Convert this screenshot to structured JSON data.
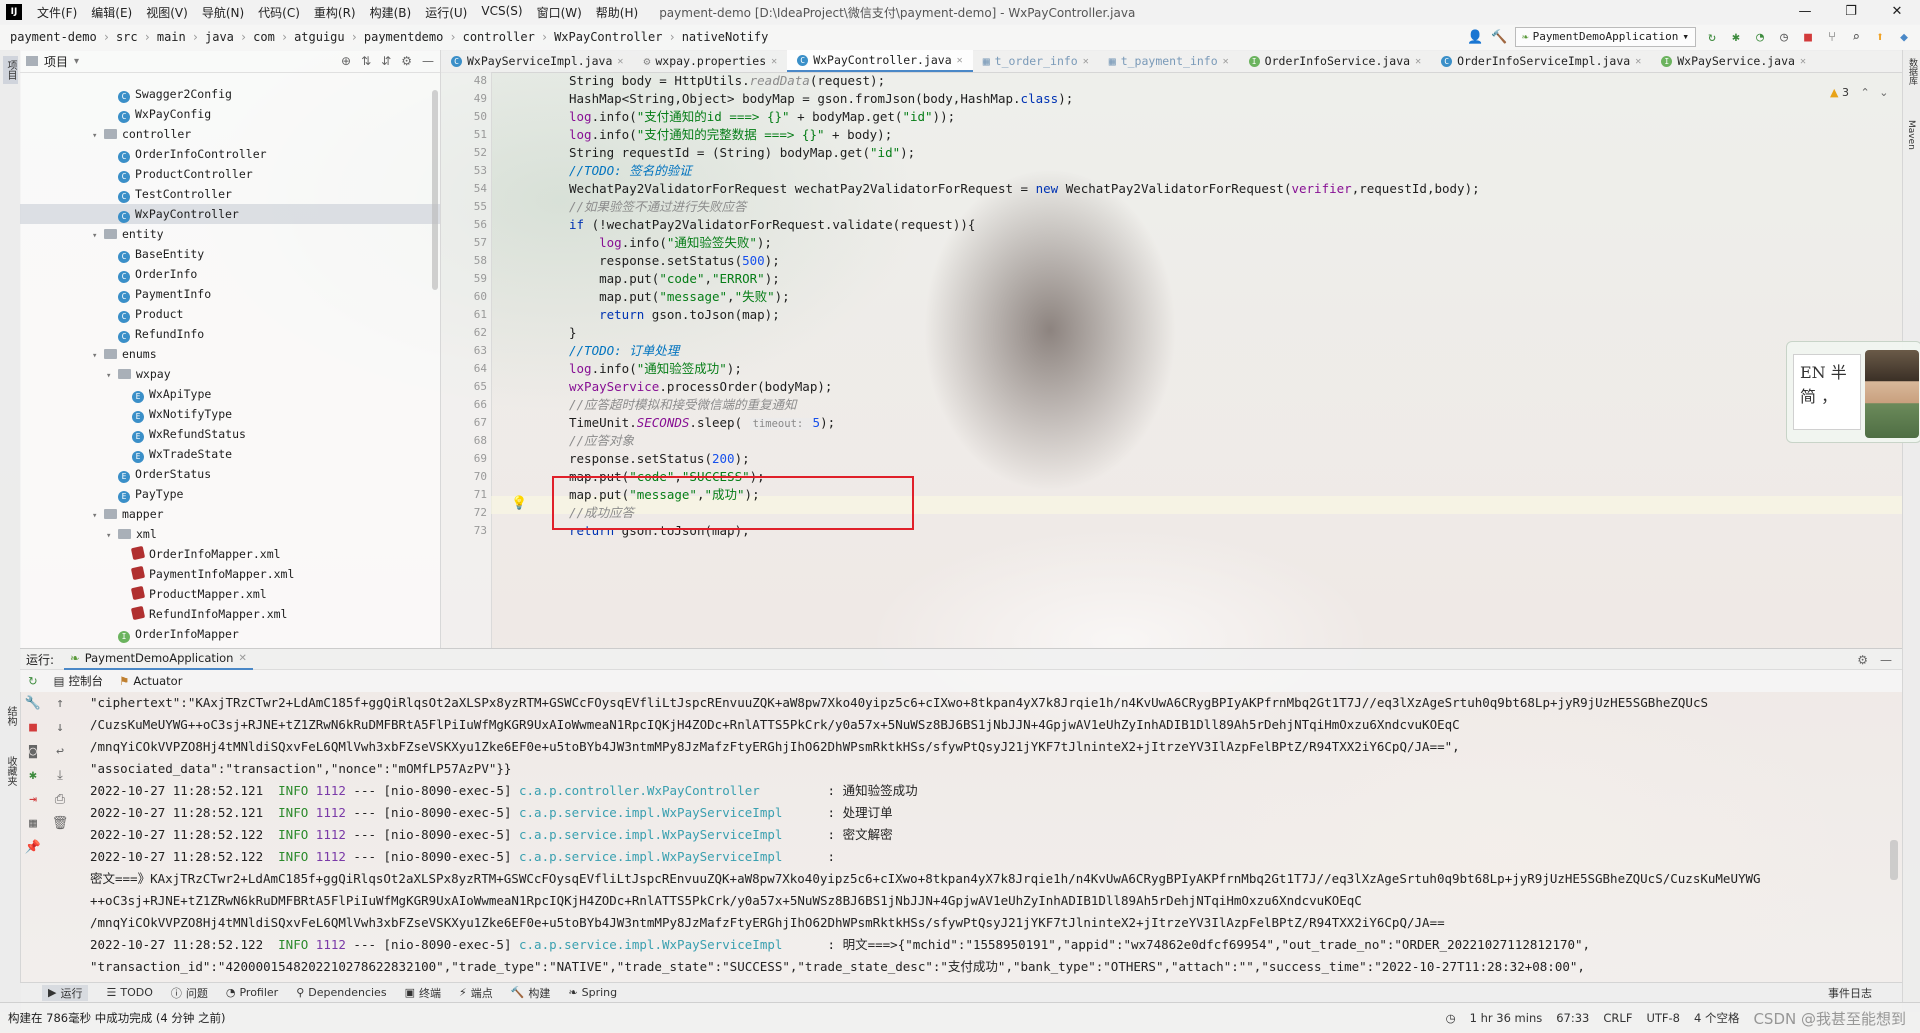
{
  "window": {
    "title": "payment-demo [D:\\IdeaProject\\微信支付\\payment-demo] - WxPayController.java",
    "logo": "IJ"
  },
  "menu": [
    "文件(F)",
    "编辑(E)",
    "视图(V)",
    "导航(N)",
    "代码(C)",
    "重构(R)",
    "构建(B)",
    "运行(U)",
    "VCS(S)",
    "窗口(W)",
    "帮助(H)"
  ],
  "breadcrumb": [
    "payment-demo",
    "src",
    "main",
    "java",
    "com",
    "atguigu",
    "paymentdemo",
    "controller",
    "WxPayController",
    "nativeNotify"
  ],
  "toolbar": {
    "run_config": "PaymentDemoApplication"
  },
  "left_strip": {
    "project": "项目",
    "structure": "结构",
    "favorites": "收藏夹"
  },
  "right_strip": {
    "database": "数据库",
    "maven": "Maven"
  },
  "project_panel": {
    "title": "项目",
    "tree": [
      {
        "label": "Swagger2Config",
        "icon": "class",
        "depth": 3
      },
      {
        "label": "WxPayConfig",
        "icon": "class",
        "depth": 3
      },
      {
        "label": "controller",
        "icon": "folder",
        "depth": 2,
        "open": true
      },
      {
        "label": "OrderInfoController",
        "icon": "class",
        "depth": 3
      },
      {
        "label": "ProductController",
        "icon": "class",
        "depth": 3
      },
      {
        "label": "TestController",
        "icon": "class",
        "depth": 3
      },
      {
        "label": "WxPayController",
        "icon": "class",
        "depth": 3,
        "selected": true
      },
      {
        "label": "entity",
        "icon": "folder",
        "depth": 2,
        "open": true
      },
      {
        "label": "BaseEntity",
        "icon": "class",
        "depth": 3
      },
      {
        "label": "OrderInfo",
        "icon": "class",
        "depth": 3
      },
      {
        "label": "PaymentInfo",
        "icon": "class",
        "depth": 3
      },
      {
        "label": "Product",
        "icon": "class",
        "depth": 3
      },
      {
        "label": "RefundInfo",
        "icon": "class",
        "depth": 3
      },
      {
        "label": "enums",
        "icon": "folder",
        "depth": 2,
        "open": true
      },
      {
        "label": "wxpay",
        "icon": "folder",
        "depth": 3,
        "open": true
      },
      {
        "label": "WxApiType",
        "icon": "enum",
        "depth": 4
      },
      {
        "label": "WxNotifyType",
        "icon": "enum",
        "depth": 4
      },
      {
        "label": "WxRefundStatus",
        "icon": "enum",
        "depth": 4
      },
      {
        "label": "WxTradeState",
        "icon": "enum",
        "depth": 4
      },
      {
        "label": "OrderStatus",
        "icon": "enum",
        "depth": 3
      },
      {
        "label": "PayType",
        "icon": "enum",
        "depth": 3
      },
      {
        "label": "mapper",
        "icon": "folder",
        "depth": 2,
        "open": true
      },
      {
        "label": "xml",
        "icon": "folder",
        "depth": 3,
        "open": true
      },
      {
        "label": "OrderInfoMapper.xml",
        "icon": "xml",
        "depth": 4
      },
      {
        "label": "PaymentInfoMapper.xml",
        "icon": "xml",
        "depth": 4
      },
      {
        "label": "ProductMapper.xml",
        "icon": "xml",
        "depth": 4
      },
      {
        "label": "RefundInfoMapper.xml",
        "icon": "xml",
        "depth": 4
      },
      {
        "label": "OrderInfoMapper",
        "icon": "interface",
        "depth": 3
      }
    ]
  },
  "tabs": [
    {
      "label": "WxPayServiceImpl.java",
      "icon": "class"
    },
    {
      "label": "wxpay.properties",
      "icon": "file"
    },
    {
      "label": "WxPayController.java",
      "icon": "class",
      "active": true
    },
    {
      "label": "t_order_info",
      "icon": "table",
      "muted": true
    },
    {
      "label": "t_payment_info",
      "icon": "table",
      "muted": true
    },
    {
      "label": "OrderInfoService.java",
      "icon": "interface"
    },
    {
      "label": "OrderInfoServiceImpl.java",
      "icon": "class"
    },
    {
      "label": "WxPayService.java",
      "icon": "interface"
    }
  ],
  "editor": {
    "warning_count": "3",
    "line_numbers": [
      "48",
      "49",
      "50",
      "51",
      "52",
      "53",
      "54",
      "55",
      "56",
      "57",
      "58",
      "59",
      "60",
      "61",
      "62",
      "63",
      "64",
      "65",
      "66",
      "67",
      "68",
      "69",
      "70",
      "71",
      "72",
      "73"
    ],
    "code": [
      [
        {
          "t": "String body = HttpUtils.",
          "c": ""
        },
        {
          "t": "readData",
          "c": "cmt"
        },
        {
          "t": "(request);",
          "c": ""
        }
      ],
      [
        {
          "t": "HashMap<String,Object> bodyMap = gson.fromJson(body,HashMap.",
          "c": ""
        },
        {
          "t": "class",
          "c": "kw"
        },
        {
          "t": ");",
          "c": ""
        }
      ],
      [
        {
          "t": "log",
          "c": "fld"
        },
        {
          "t": ".info(",
          "c": ""
        },
        {
          "t": "\"支付通知的id ===> {}\"",
          "c": "str"
        },
        {
          "t": " + bodyMap.get(",
          "c": ""
        },
        {
          "t": "\"id\"",
          "c": "str"
        },
        {
          "t": "));",
          "c": ""
        }
      ],
      [
        {
          "t": "log",
          "c": "fld"
        },
        {
          "t": ".info(",
          "c": ""
        },
        {
          "t": "\"支付通知的完整数据 ===> {}\"",
          "c": "str"
        },
        {
          "t": " + body);",
          "c": ""
        }
      ],
      [
        {
          "t": "String requestId = (String) bodyMap.get(",
          "c": ""
        },
        {
          "t": "\"id\"",
          "c": "str"
        },
        {
          "t": ");",
          "c": ""
        }
      ],
      [
        {
          "t": "//TODO:",
          "c": "todo"
        },
        {
          "t": " 签名的验证",
          "c": "todo"
        }
      ],
      [
        {
          "t": "WechatPay2ValidatorForRequest wechatPay2ValidatorForRequest = ",
          "c": ""
        },
        {
          "t": "new",
          "c": "kw"
        },
        {
          "t": " WechatPay2ValidatorForRequest(",
          "c": ""
        },
        {
          "t": "verifier",
          "c": "fld"
        },
        {
          "t": ",requestId,body);",
          "c": ""
        }
      ],
      [
        {
          "t": "//如果验签不通过进行失败应答",
          "c": "cmt"
        }
      ],
      [
        {
          "t": "if",
          "c": "kw"
        },
        {
          "t": " (!wechatPay2ValidatorForRequest.validate(request)){",
          "c": ""
        }
      ],
      [
        {
          "t": "    ",
          "c": ""
        },
        {
          "t": "log",
          "c": "fld"
        },
        {
          "t": ".info(",
          "c": ""
        },
        {
          "t": "\"通知验签失败\"",
          "c": "str"
        },
        {
          "t": ");",
          "c": ""
        }
      ],
      [
        {
          "t": "    response.setStatus(",
          "c": ""
        },
        {
          "t": "500",
          "c": "num"
        },
        {
          "t": ");",
          "c": ""
        }
      ],
      [
        {
          "t": "    map.put(",
          "c": ""
        },
        {
          "t": "\"code\"",
          "c": "str"
        },
        {
          "t": ",",
          "c": ""
        },
        {
          "t": "\"ERROR\"",
          "c": "str"
        },
        {
          "t": ");",
          "c": ""
        }
      ],
      [
        {
          "t": "    map.put(",
          "c": ""
        },
        {
          "t": "\"message\"",
          "c": "str"
        },
        {
          "t": ",",
          "c": ""
        },
        {
          "t": "\"失败\"",
          "c": "str"
        },
        {
          "t": ");",
          "c": ""
        }
      ],
      [
        {
          "t": "    ",
          "c": ""
        },
        {
          "t": "return",
          "c": "kw"
        },
        {
          "t": " gson.toJson(map);",
          "c": ""
        }
      ],
      [
        {
          "t": "}",
          "c": ""
        }
      ],
      [
        {
          "t": "//TODO:",
          "c": "todo"
        },
        {
          "t": " 订单处理",
          "c": "todo"
        }
      ],
      [
        {
          "t": "log",
          "c": "fld"
        },
        {
          "t": ".info(",
          "c": ""
        },
        {
          "t": "\"通知验签成功\"",
          "c": "str"
        },
        {
          "t": ");",
          "c": ""
        }
      ],
      [
        {
          "t": "wxPayService",
          "c": "fld"
        },
        {
          "t": ".processOrder(bodyMap);",
          "c": ""
        }
      ],
      [
        {
          "t": "//应答超时模拟和接受微信端的重复通知",
          "c": "cmt"
        }
      ],
      [
        {
          "t": "TimeUnit.",
          "c": ""
        },
        {
          "t": "SECONDS",
          "c": "sfld"
        },
        {
          "t": ".sleep( ",
          "c": ""
        },
        {
          "t": "timeout: ",
          "c": "hint"
        },
        {
          "t": "5",
          "c": "num"
        },
        {
          "t": ");",
          "c": ""
        }
      ],
      [
        {
          "t": "//应答对象",
          "c": "cmt"
        }
      ],
      [
        {
          "t": "response.setStatus(",
          "c": ""
        },
        {
          "t": "200",
          "c": "num"
        },
        {
          "t": ");",
          "c": ""
        }
      ],
      [
        {
          "t": "map.put(",
          "c": ""
        },
        {
          "t": "\"code\"",
          "c": "str"
        },
        {
          "t": ",",
          "c": ""
        },
        {
          "t": "\"SUCCESS\"",
          "c": "str"
        },
        {
          "t": ");",
          "c": ""
        }
      ],
      [
        {
          "t": "map.put(",
          "c": ""
        },
        {
          "t": "\"message\"",
          "c": "str"
        },
        {
          "t": ",",
          "c": ""
        },
        {
          "t": "\"成功\"",
          "c": "str"
        },
        {
          "t": ");",
          "c": ""
        }
      ],
      [
        {
          "t": "//成功应答",
          "c": "cmt"
        }
      ],
      [
        {
          "t": "return",
          "c": "kw"
        },
        {
          "t": " gson.toJson(map);",
          "c": ""
        }
      ]
    ]
  },
  "ime": {
    "line1": "EN 半",
    "line2": "简 ，"
  },
  "run_panel": {
    "label": "运行:",
    "app_tab": "PaymentDemoApplication",
    "subtabs": [
      "控制台",
      "Actuator"
    ],
    "console": [
      [
        {
          "t": "\"ciphertext\":\"KAxjTRzCTwr2+LdAmC185f+ggQiRlqsOt2aXLSPx8yzRTM+GSWCcFOysqEVfliLtJspcREnvuuZQK+aW8pw7Xko40yipz5c6+cIXwo+8tkpan4yX7k8Jrqie1h/n4KvUwA6CRygBPIyAKPfrnMbq2Gt1T7J//eq3lXzAgeSrtuh0q9bt68Lp+jyR9jUzHE5SGBheZQUcS",
          "c": ""
        }
      ],
      [
        {
          "t": "/CuzsKuMeUYWG++oC3sj+RJNE+tZ1ZRwN6kRuDMFBRtA5FlPiIuWfMgKGR9UxAIoWwmeaN1RpcIQKjH4ZODc+RnlATTS5PkCrk/y0a57x+5NuWSz8BJ6BS1jNbJJN+4GpjwAV1eUhZyInhADIB1Dll89Ah5rDehjNTqiHmOxzu6XndcvuKOEqC",
          "c": ""
        }
      ],
      [
        {
          "t": "/mnqYiCOkVVPZO8Hj4tMNldiSQxvFeL6QMlVwh3xbFZseVSKXyu1Zke6EF0e+u5toBYb4JW3ntmMPy8JzMafzFtyERGhjIhO62DhWPsmRktkHSs/sfywPtQsyJ21jYKF7tJlninteX2+jItrzeYV3IlAzpFelBPtZ/R94TXX2iY6CpQ/JA==\",",
          "c": ""
        }
      ],
      [
        {
          "t": "\"associated_data\":\"transaction\",\"nonce\":\"mOMfLP57AzPV\"}}",
          "c": ""
        }
      ],
      [
        {
          "t": "2022-10-27 11:28:52.121  ",
          "c": ""
        },
        {
          "t": "INFO",
          "c": "info"
        },
        {
          "t": " ",
          "c": ""
        },
        {
          "t": "1112",
          "c": "pid"
        },
        {
          "t": " --- [nio-8090-exec-5] ",
          "c": ""
        },
        {
          "t": "c.a.p.controller.WxPayController        ",
          "c": "logger"
        },
        {
          "t": " : 通知验签成功",
          "c": ""
        }
      ],
      [
        {
          "t": "2022-10-27 11:28:52.121  ",
          "c": ""
        },
        {
          "t": "INFO",
          "c": "info"
        },
        {
          "t": " ",
          "c": ""
        },
        {
          "t": "1112",
          "c": "pid"
        },
        {
          "t": " --- [nio-8090-exec-5] ",
          "c": ""
        },
        {
          "t": "c.a.p.service.impl.WxPayServiceImpl     ",
          "c": "logger"
        },
        {
          "t": " : 处理订单",
          "c": ""
        }
      ],
      [
        {
          "t": "2022-10-27 11:28:52.122  ",
          "c": ""
        },
        {
          "t": "INFO",
          "c": "info"
        },
        {
          "t": " ",
          "c": ""
        },
        {
          "t": "1112",
          "c": "pid"
        },
        {
          "t": " --- [nio-8090-exec-5] ",
          "c": ""
        },
        {
          "t": "c.a.p.service.impl.WxPayServiceImpl     ",
          "c": "logger"
        },
        {
          "t": " : 密文解密",
          "c": ""
        }
      ],
      [
        {
          "t": "2022-10-27 11:28:52.122  ",
          "c": ""
        },
        {
          "t": "INFO",
          "c": "info"
        },
        {
          "t": " ",
          "c": ""
        },
        {
          "t": "1112",
          "c": "pid"
        },
        {
          "t": " --- [nio-8090-exec-5] ",
          "c": ""
        },
        {
          "t": "c.a.p.service.impl.WxPayServiceImpl     ",
          "c": "logger"
        },
        {
          "t": " : ",
          "c": ""
        }
      ],
      [
        {
          "t": "密文===》KAxjTRzCTwr2+LdAmC185f+ggQiRlqsOt2aXLSPx8yzRTM+GSWCcFOysqEVfliLtJspcREnvuuZQK+aW8pw7Xko40yipz5c6+cIXwo+8tkpan4yX7k8Jrqie1h/n4KvUwA6CRygBPIyAKPfrnMbq2Gt1T7J//eq3lXzAgeSrtuh0q9bt68Lp+jyR9jUzHE5SGBheZQUcS/CuzsKuMeUYWG",
          "c": ""
        }
      ],
      [
        {
          "t": "++oC3sj+RJNE+tZ1ZRwN6kRuDMFBRtA5FlPiIuWfMgKGR9UxAIoWwmeaN1RpcIQKjH4ZODc+RnlATTS5PkCrk/y0a57x+5NuWSz8BJ6BS1jNbJJN+4GpjwAV1eUhZyInhADIB1Dll89Ah5rDehjNTqiHmOxzu6XndcvuKOEqC",
          "c": ""
        }
      ],
      [
        {
          "t": "/mnqYiCOkVVPZO8Hj4tMNldiSQxvFeL6QMlVwh3xbFZseVSKXyu1Zke6EF0e+u5toBYb4JW3ntmMPy8JzMafzFtyERGhjIhO62DhWPsmRktkHSs/sfywPtQsyJ21jYKF7tJlninteX2+jItrzeYV3IlAzpFelBPtZ/R94TXX2iY6CpQ/JA==",
          "c": ""
        }
      ],
      [
        {
          "t": "2022-10-27 11:28:52.122  ",
          "c": ""
        },
        {
          "t": "INFO",
          "c": "info"
        },
        {
          "t": " ",
          "c": ""
        },
        {
          "t": "1112",
          "c": "pid"
        },
        {
          "t": " --- [nio-8090-exec-5] ",
          "c": ""
        },
        {
          "t": "c.a.p.service.impl.WxPayServiceImpl     ",
          "c": "logger"
        },
        {
          "t": " : 明文===>{\"mchid\":\"1558950191\",\"appid\":\"wx74862e0dfcf69954\",\"out_trade_no\":\"ORDER_20221027112812170\",",
          "c": ""
        }
      ],
      [
        {
          "t": "\"transaction_id\":\"4200001548202210278622832100\",\"trade_type\":\"NATIVE\",\"trade_state\":\"SUCCESS\",\"trade_state_desc\":\"支付成功\",\"bank_type\":\"OTHERS\",\"attach\":\"\",\"success_time\":\"2022-10-27T11:28:32+08:00\",",
          "c": ""
        }
      ]
    ]
  },
  "bottom_tools": [
    "运行",
    "TODO",
    "问题",
    "Profiler",
    "Dependencies",
    "终端",
    "端点",
    "构建",
    "Spring"
  ],
  "event_log": "事件日志",
  "status": {
    "message": "构建在 786毫秒 中成功完成 (4 分钟 之前)",
    "time": "1 hr 36 mins",
    "position": "67:33",
    "line_sep": "CRLF",
    "encoding": "UTF-8",
    "indent": "4 个空格",
    "watermark": "CSDN @我甚至能想到"
  }
}
